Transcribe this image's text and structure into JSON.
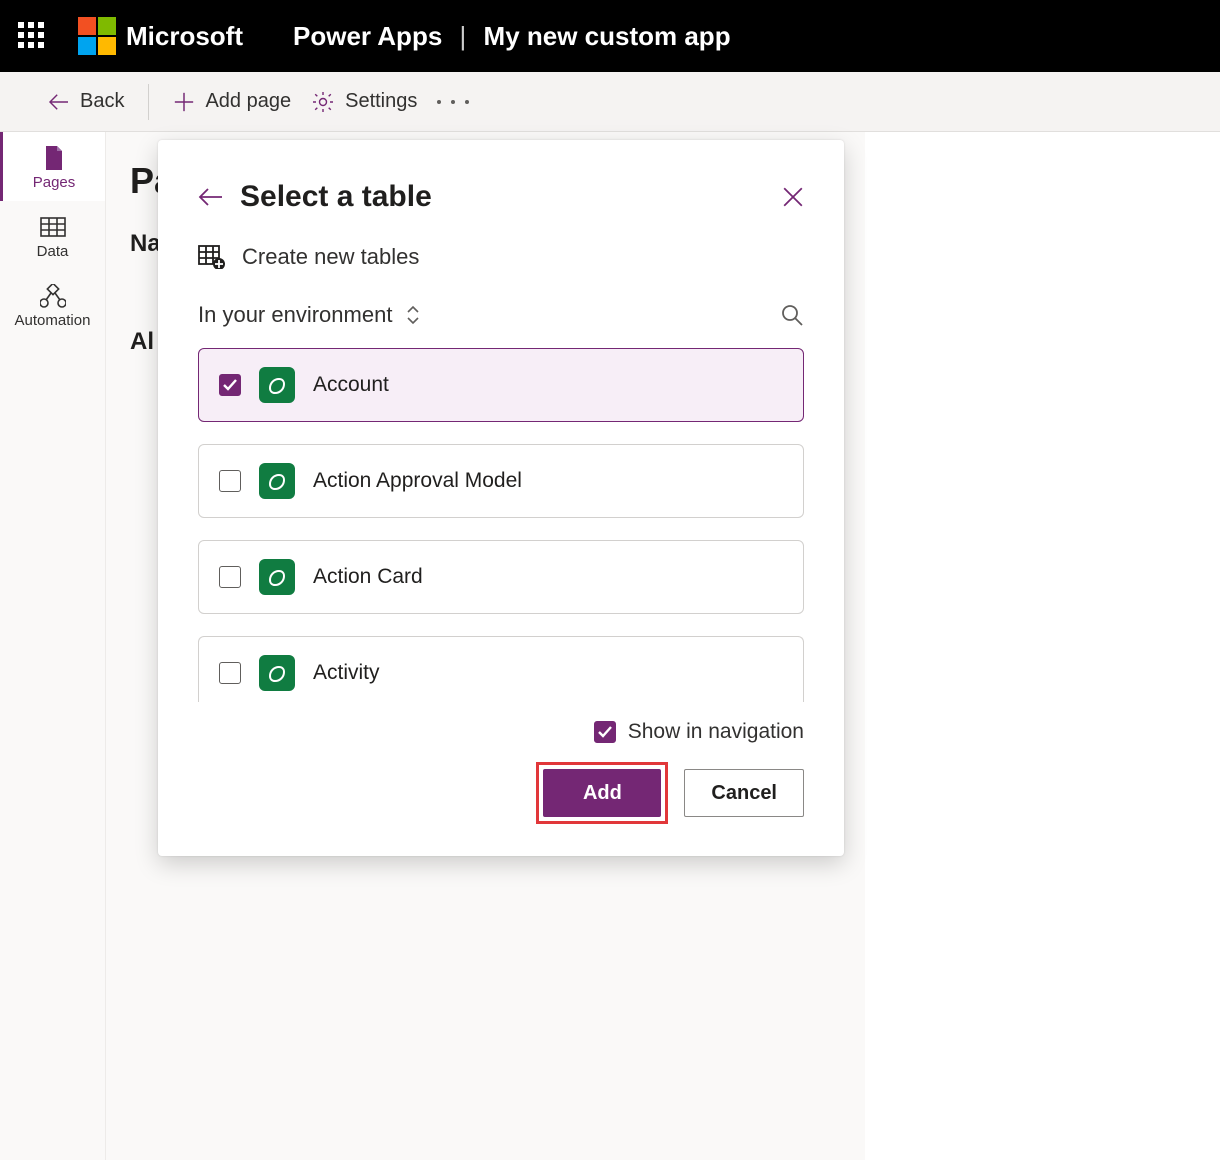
{
  "header": {
    "brand": "Microsoft",
    "app_name": "Power Apps",
    "app_context": "My new custom app"
  },
  "toolbar": {
    "back_label": "Back",
    "add_page_label": "Add page",
    "settings_label": "Settings"
  },
  "left_rail": {
    "items": [
      {
        "label": "Pages"
      },
      {
        "label": "Data"
      },
      {
        "label": "Automation"
      }
    ]
  },
  "page": {
    "title_visible": "Pa",
    "row_label": "Na",
    "row2_label": "Al"
  },
  "dialog": {
    "title": "Select a table",
    "create_new_label": "Create new tables",
    "env_label": "In your environment",
    "tables": [
      {
        "name": "Account",
        "checked": true
      },
      {
        "name": "Action Approval Model",
        "checked": false
      },
      {
        "name": "Action Card",
        "checked": false
      },
      {
        "name": "Activity",
        "checked": false
      }
    ],
    "show_in_nav_label": "Show in navigation",
    "show_in_nav_checked": true,
    "add_label": "Add",
    "cancel_label": "Cancel"
  }
}
